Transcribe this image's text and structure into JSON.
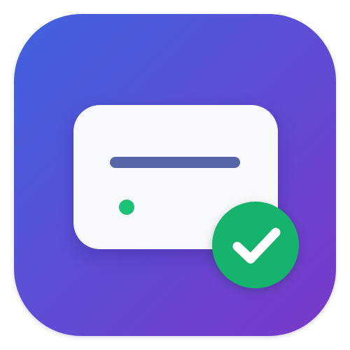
{
  "icon": {
    "name": "drive-check-icon",
    "colors": {
      "tile_gradient_start": "#3f63de",
      "tile_gradient_mid": "#5b4fd6",
      "tile_gradient_end": "#7a38c8",
      "card": "#f8f9fc",
      "slot": "#5565a8",
      "led": "#1ec277",
      "badge": "#15b36c",
      "checkmark": "#ffffff"
    },
    "parts": {
      "card": "drive-card",
      "slot": "slot-bar",
      "led": "status-led",
      "badge": "checkmark-badge"
    }
  }
}
